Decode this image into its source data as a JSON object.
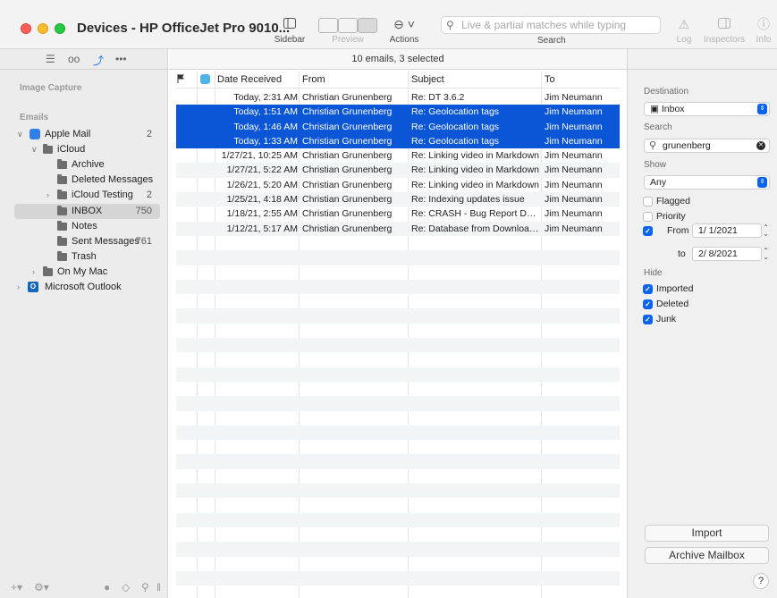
{
  "window": {
    "title": "Devices - HP OfficeJet Pro 9010..."
  },
  "toolbar": {
    "sidebar_label": "Sidebar",
    "preview_label": "Preview",
    "actions_label": "Actions",
    "search_placeholder": "Live & partial matches while typing",
    "search_label": "Search",
    "log_label": "Log",
    "inspectors_label": "Inspectors",
    "info_label": "Info"
  },
  "sidebar": {
    "section_image_capture": "Image Capture",
    "section_emails": "Emails",
    "items": [
      {
        "label": "Apple Mail",
        "count": "2"
      },
      {
        "label": "iCloud",
        "count": ""
      },
      {
        "label": "Archive",
        "count": ""
      },
      {
        "label": "Deleted Messages",
        "count": ""
      },
      {
        "label": "iCloud Testing",
        "count": "2"
      },
      {
        "label": "INBOX",
        "count": "750"
      },
      {
        "label": "Notes",
        "count": ""
      },
      {
        "label": "Sent Messages",
        "count": "761"
      },
      {
        "label": "Trash",
        "count": ""
      },
      {
        "label": "On My Mac",
        "count": ""
      },
      {
        "label": "Microsoft Outlook",
        "count": ""
      }
    ]
  },
  "list": {
    "status": "10 emails, 3 selected",
    "columns": {
      "date": "Date Received",
      "from": "From",
      "subject": "Subject",
      "to": "To"
    },
    "rows": [
      {
        "date": "Today, 2:31 AM",
        "from": "Christian Grunenberg",
        "subject": "Re: DT 3.6.2",
        "to": "Jim Neumann",
        "selected": false
      },
      {
        "date": "Today, 1:51 AM",
        "from": "Christian Grunenberg",
        "subject": "Re: Geolocation tags",
        "to": "Jim Neumann",
        "selected": true
      },
      {
        "date": "Today, 1:46 AM",
        "from": "Christian Grunenberg",
        "subject": "Re: Geolocation tags",
        "to": "Jim Neumann",
        "selected": true
      },
      {
        "date": "Today, 1:33 AM",
        "from": "Christian Grunenberg",
        "subject": "Re: Geolocation tags",
        "to": "Jim Neumann",
        "selected": true
      },
      {
        "date": "1/27/21, 10:25 AM",
        "from": "Christian Grunenberg",
        "subject": "Re: Linking video in Markdown",
        "to": "Jim Neumann",
        "selected": false
      },
      {
        "date": "1/27/21, 5:22 AM",
        "from": "Christian Grunenberg",
        "subject": "Re: Linking video in Markdown",
        "to": "Jim Neumann",
        "selected": false
      },
      {
        "date": "1/26/21, 5:20 AM",
        "from": "Christian Grunenberg",
        "subject": "Re: Linking video in Markdown",
        "to": "Jim Neumann",
        "selected": false
      },
      {
        "date": "1/25/21, 4:18 AM",
        "from": "Christian Grunenberg",
        "subject": "Re: Indexing updates issue",
        "to": "Jim Neumann",
        "selected": false
      },
      {
        "date": "1/18/21, 2:55 AM",
        "from": "Christian Grunenberg",
        "subject": "Re: CRASH - Bug Report DEV...",
        "to": "Jim Neumann",
        "selected": false
      },
      {
        "date": "1/12/21, 5:17 AM",
        "from": "Christian Grunenberg",
        "subject": "Re: Database from Download...",
        "to": "Jim Neumann",
        "selected": false
      }
    ]
  },
  "inspector": {
    "destination_label": "Destination",
    "destination_value": "Inbox",
    "search_label": "Search",
    "search_value": "grunenberg",
    "show_label": "Show",
    "show_value": "Any",
    "flagged_label": "Flagged",
    "priority_label": "Priority",
    "from_label": "From",
    "from_date": "1/ 1/2021",
    "to_label": "to",
    "to_date": "2/ 8/2021",
    "hide_label": "Hide",
    "imported_label": "Imported",
    "deleted_label": "Deleted",
    "junk_label": "Junk",
    "import_button": "Import",
    "archive_button": "Archive Mailbox",
    "help_button": "?"
  },
  "colors": {
    "selection": "#0a56d6",
    "accent": "#0a64f0"
  }
}
